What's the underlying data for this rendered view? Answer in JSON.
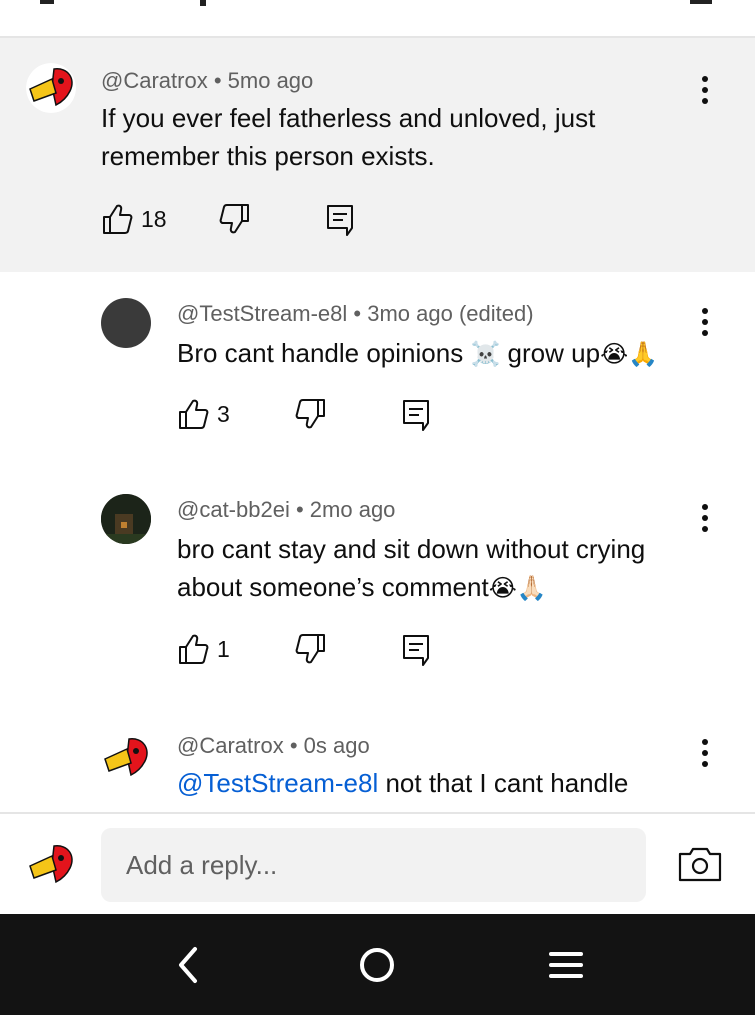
{
  "comments": [
    {
      "handle": "@Caratrox",
      "time": "5mo ago",
      "text": "If you ever feel fatherless and unloved, just remember this person exists.",
      "likes": "18"
    },
    {
      "handle": "@TestStream-e8l",
      "time": "3mo ago (edited)",
      "text": "Bro cant handle opinions",
      "text_emoji_1": "☠️",
      "text_2": " grow up",
      "text_emoji_2": "😭🙏",
      "likes": "3"
    },
    {
      "handle": "@cat-bb2ei",
      "time": "2mo ago",
      "text": "bro cant stay and sit down without crying about someone’s comment",
      "text_emoji": "😭🙏🏻",
      "likes": "1"
    },
    {
      "handle": "@Caratrox",
      "time": "0s ago",
      "mention": "@TestStream-e8l",
      "text": " not that I cant handle"
    }
  ],
  "reply_bar": {
    "placeholder": "Add a reply..."
  },
  "colors": {
    "link": "#065fd4",
    "parent_bg": "#f2f2f2",
    "nav_bg": "#131313"
  },
  "icons": [
    "like-icon",
    "dislike-icon",
    "reply-icon",
    "more-options-icon",
    "camera-icon",
    "nav-back-icon",
    "nav-home-icon",
    "nav-recents-icon"
  ]
}
